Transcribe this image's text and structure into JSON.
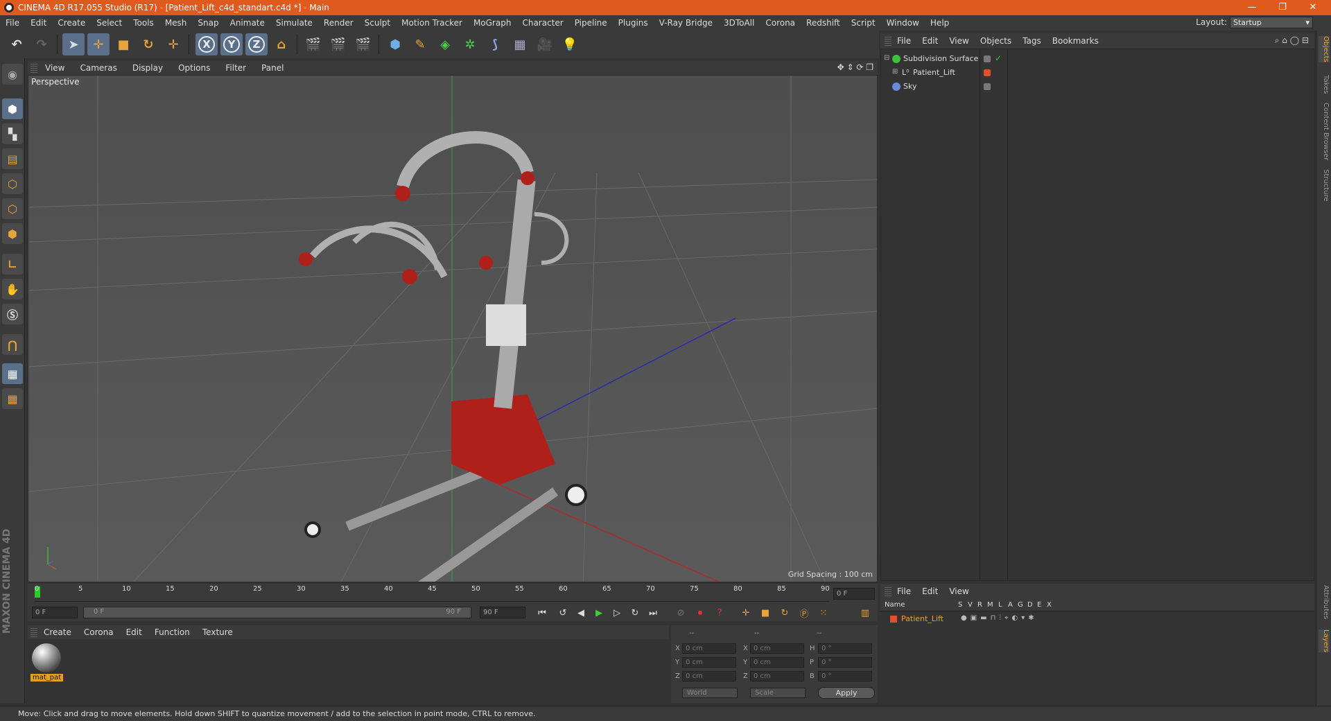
{
  "window": {
    "title": "CINEMA 4D R17.055 Studio (R17) - [Patient_Lift_c4d_standart.c4d *] - Main",
    "minimize": "—",
    "restore": "❐",
    "close": "✕"
  },
  "menu": [
    "File",
    "Edit",
    "Create",
    "Select",
    "Tools",
    "Mesh",
    "Snap",
    "Animate",
    "Simulate",
    "Render",
    "Sculpt",
    "Motion Tracker",
    "MoGraph",
    "Character",
    "Pipeline",
    "Plugins",
    "V-Ray Bridge",
    "3DToAll",
    "Corona",
    "Redshift",
    "Script",
    "Window",
    "Help"
  ],
  "layout": {
    "label": "Layout:",
    "value": "Startup"
  },
  "toolbar": {
    "x_label": "X",
    "y_label": "Y",
    "z_label": "Z"
  },
  "viewport": {
    "menu": [
      "View",
      "Cameras",
      "Display",
      "Options",
      "Filter",
      "Panel"
    ],
    "label": "Perspective",
    "grid_spacing": "Grid Spacing : 100 cm"
  },
  "timeline": {
    "ticks": [
      "0",
      "5",
      "10",
      "15",
      "20",
      "25",
      "30",
      "35",
      "40",
      "45",
      "50",
      "55",
      "60",
      "65",
      "70",
      "75",
      "80",
      "85",
      "90"
    ],
    "current_frame": "0 F",
    "start_field": "0 F",
    "range_start": "0 F",
    "range_end": "90 F",
    "end_field": "90 F"
  },
  "material_manager": {
    "menu": [
      "Create",
      "Corona",
      "Edit",
      "Function",
      "Texture"
    ],
    "materials": [
      {
        "name": "mat_pat"
      }
    ]
  },
  "coordinates": {
    "headers": [
      "--",
      "--",
      "--"
    ],
    "rows": [
      {
        "a_label": "X",
        "a_val": "0 cm",
        "b_label": "X",
        "b_val": "0 cm",
        "c_label": "H",
        "c_val": "0 °"
      },
      {
        "a_label": "Y",
        "a_val": "0 cm",
        "b_label": "Y",
        "b_val": "0 cm",
        "c_label": "P",
        "c_val": "0 °"
      },
      {
        "a_label": "Z",
        "a_val": "0 cm",
        "b_label": "Z",
        "b_val": "0 cm",
        "c_label": "B",
        "c_val": "0 °"
      }
    ],
    "space": "World",
    "mode": "Scale",
    "apply": "Apply"
  },
  "status": "Move: Click and drag to move elements. Hold down SHIFT to quantize movement / add to the selection in point mode, CTRL to remove.",
  "object_manager": {
    "menu": [
      "File",
      "Edit",
      "View",
      "Objects",
      "Tags",
      "Bookmarks"
    ],
    "objects": [
      {
        "name": "Subdivision Surface",
        "color": "#7a7a7a"
      },
      {
        "name": "Patient_Lift",
        "color": "#e05030"
      },
      {
        "name": "Sky",
        "color": "#7a7a7a"
      }
    ]
  },
  "layers_manager": {
    "menu": [
      "File",
      "Edit",
      "View"
    ],
    "columns": [
      "Name",
      "S",
      "V",
      "R",
      "M",
      "L",
      "A",
      "G",
      "D",
      "E",
      "X"
    ],
    "layers": [
      {
        "name": "Patient_Lift",
        "color": "#e05030"
      }
    ]
  },
  "right_tabs": [
    "Objects",
    "Takes",
    "Content Browser",
    "Structure",
    "Attributes",
    "Layers"
  ],
  "brand": "MAXON CINEMA 4D"
}
